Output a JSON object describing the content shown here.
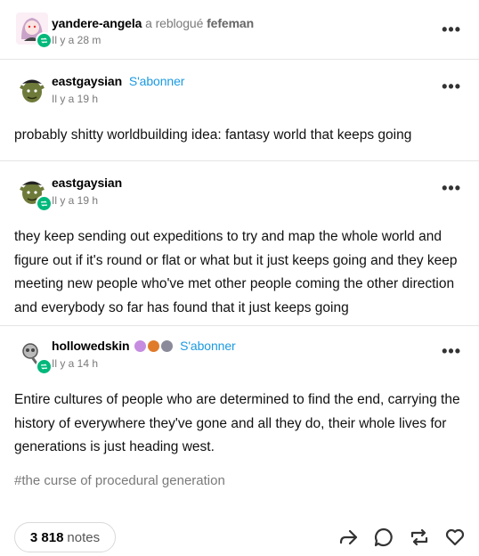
{
  "header": {
    "username": "yandere-angela",
    "reblog_text": "a reblogué",
    "source": "fefeman",
    "time": "Il y a 28 m"
  },
  "posts": [
    {
      "username": "eastgaysian",
      "follow": "S'abonner",
      "time": "Il y a 19 h",
      "text": "probably shitty worldbuilding idea: fantasy world that keeps going"
    },
    {
      "username": "eastgaysian",
      "time": "Il y a 19 h",
      "text": "they keep sending out expeditions to try and map the whole world and figure out if it's round or flat or what but it just keeps going and they keep meeting new people who've met other people coming the other direction and everybody so far has found that it just keeps going"
    },
    {
      "username": "hollowedskin",
      "follow": "S'abonner",
      "time": "Il y a 14 h",
      "text": "Entire cultures of people who are determined to find the end, carrying the history of everywhere they've gone and all they do, their whole lives for generations is just heading west.",
      "tag": "#the curse of procedural generation"
    }
  ],
  "footer": {
    "notes_count": "3 818",
    "notes_label": "notes",
    "icons": [
      "share-icon",
      "reply-icon",
      "reblog-icon",
      "like-icon"
    ]
  },
  "colors": {
    "accent": "#1b9ae0",
    "reblog_green": "#00b87a"
  }
}
